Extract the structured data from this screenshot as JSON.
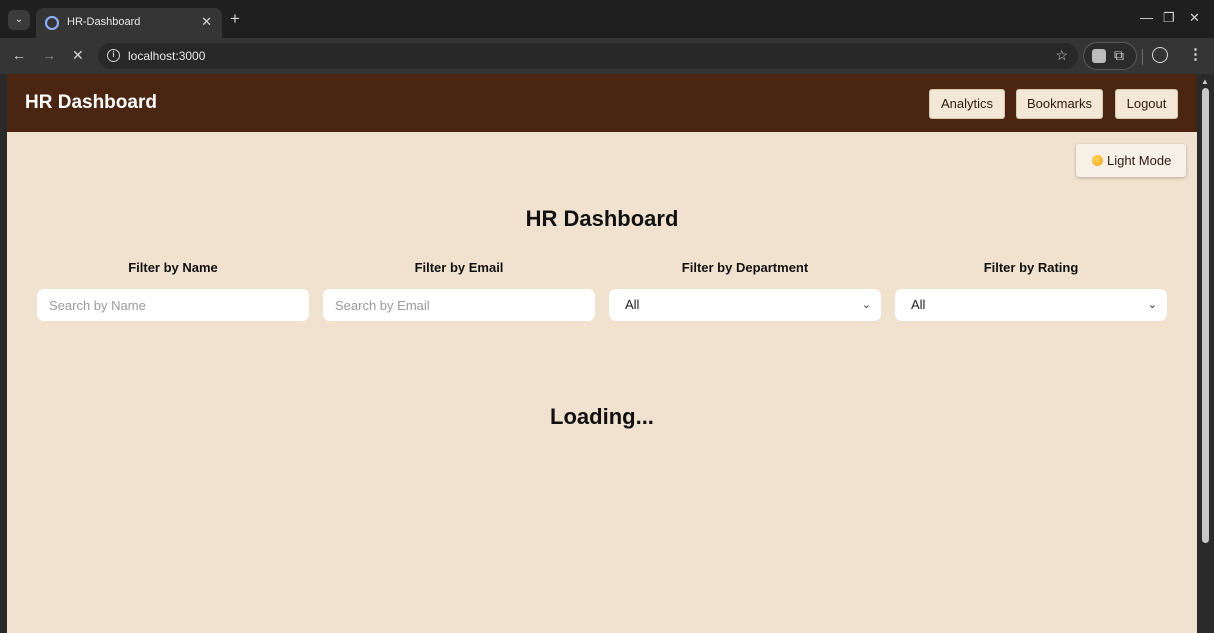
{
  "browser": {
    "tab_title": "HR-Dashboard",
    "url": "localhost:3000"
  },
  "navbar": {
    "brand": "HR Dashboard",
    "buttons": [
      "Analytics",
      "Bookmarks",
      "Logout"
    ]
  },
  "theme_toggle": {
    "label": "Light Mode",
    "icon": "sun-icon"
  },
  "main": {
    "title": "HR Dashboard",
    "loading_text": "Loading..."
  },
  "filters": {
    "name": {
      "label": "Filter by Name",
      "placeholder": "Search by Name",
      "value": ""
    },
    "email": {
      "label": "Filter by Email",
      "placeholder": "Search by Email",
      "value": ""
    },
    "department": {
      "label": "Filter by Department",
      "selected": "All"
    },
    "rating": {
      "label": "Filter by Rating",
      "selected": "All"
    }
  }
}
